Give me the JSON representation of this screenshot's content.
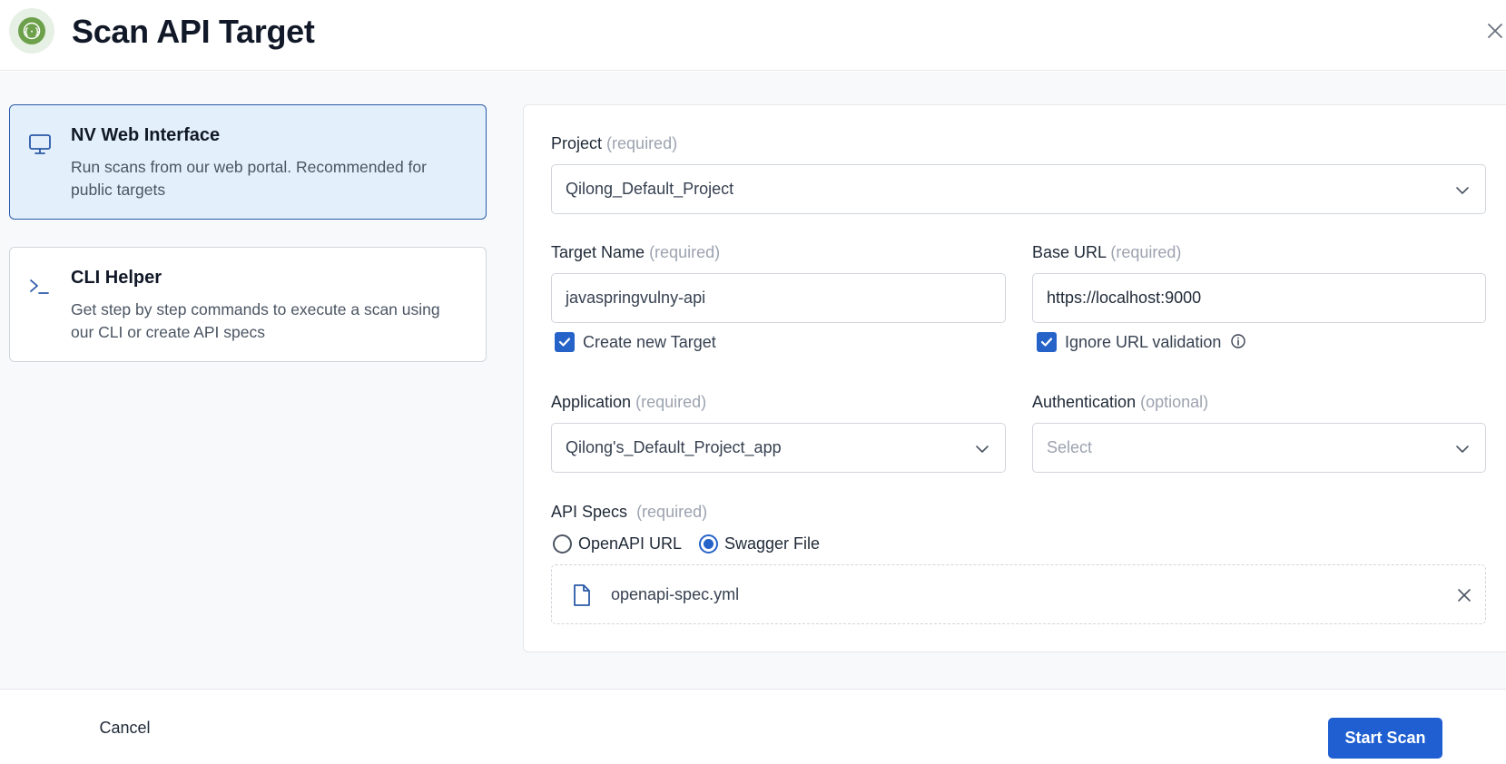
{
  "header": {
    "title": "Scan API Target",
    "logo_icon": "api-braces-icon",
    "close_icon": "close-icon"
  },
  "options": [
    {
      "title": "NV Web Interface",
      "description": "Run scans from our web portal. Recommended for public targets",
      "icon": "monitor-icon",
      "selected": true
    },
    {
      "title": "CLI Helper",
      "description": "Get step by step commands to execute a scan using our CLI or create API specs",
      "icon": "terminal-prompt-icon",
      "selected": false
    }
  ],
  "form": {
    "project": {
      "label": "Project",
      "hint": "(required)",
      "value": "Qilong_Default_Project"
    },
    "target_name": {
      "label": "Target Name",
      "hint": "(required)",
      "value": "javaspringvulny-api",
      "checkbox_label": "Create new Target",
      "checked": true
    },
    "base_url": {
      "label": "Base URL",
      "hint": "(required)",
      "value": "https://localhost:9000",
      "checkbox_label": "Ignore URL validation",
      "checked": true
    },
    "application": {
      "label": "Application",
      "hint": "(required)",
      "value": "Qilong's_Default_Project_app"
    },
    "authentication": {
      "label": "Authentication",
      "hint": "(optional)",
      "placeholder": "Select"
    },
    "api_specs": {
      "label": "API Specs",
      "hint": "(required)",
      "options": [
        "OpenAPI URL",
        "Swagger File"
      ],
      "selected": "Swagger File",
      "file_name": "openapi-spec.yml"
    }
  },
  "footer": {
    "cancel_label": "Cancel",
    "start_label": "Start Scan"
  },
  "colors": {
    "primary": "#1f5fd1",
    "selected_card_bg": "#e3f0fb",
    "selected_card_border": "#2b5aa8",
    "logo_green": "#6ca04a"
  }
}
